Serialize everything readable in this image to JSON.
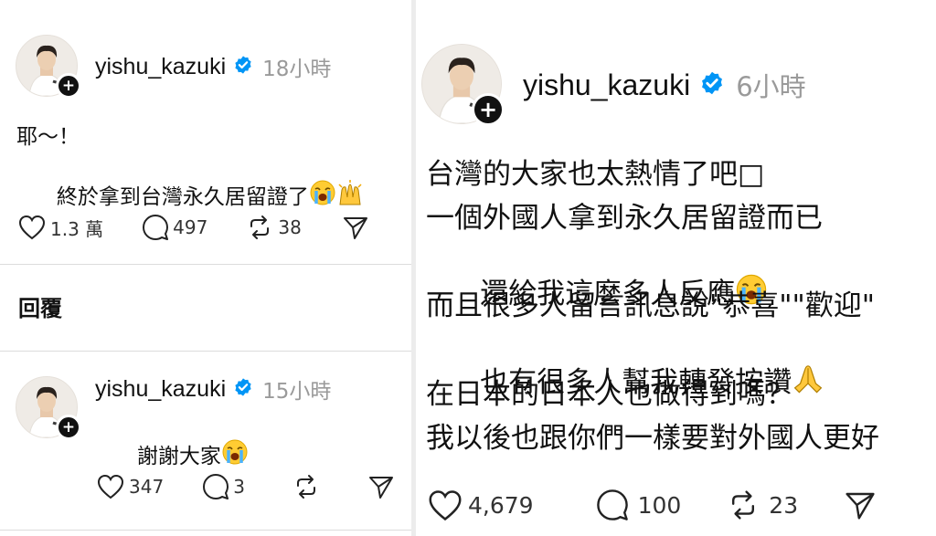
{
  "left": {
    "post1": {
      "username": "yishu_kazuki",
      "time": "18小時",
      "line1": "耶～！",
      "line2": "終於拿到台灣永久居留證了",
      "likes": "1.3 萬",
      "comments": "497",
      "reposts": "38"
    },
    "reply_label": "回覆",
    "post2": {
      "username": "yishu_kazuki",
      "time": "15小時",
      "text": "謝謝大家",
      "likes": "347",
      "comments": "3",
      "reposts": ""
    }
  },
  "right": {
    "post": {
      "username": "yishu_kazuki",
      "time": "6小時",
      "lines": [
        "台灣的大家也太熱情了吧□",
        "一個外國人拿到永久居留證而已",
        "還給我這麼多人反應",
        "而且很多人留言訊息說\"恭喜\"\"歡迎\"",
        "也有很多人幫我轉發按讚",
        "在日本的日本人也做得到嗎？",
        "我以後也跟你們一樣要對外國人更好"
      ],
      "likes": "4,679",
      "comments": "100",
      "reposts": "23"
    }
  },
  "icons": {
    "verified": "verified-badge-icon",
    "like": "heart-icon",
    "comment": "comment-bubble-icon",
    "repost": "repost-icon",
    "share": "send-icon",
    "follow": "plus-icon",
    "emoji_cry": "loudly-crying-face-emoji",
    "emoji_hands": "raising-hands-emoji",
    "emoji_pray": "folded-hands-emoji"
  },
  "colors": {
    "verified_blue": "#0095f6",
    "muted_text": "#9a9a9a",
    "divider": "#dcdcdc"
  }
}
